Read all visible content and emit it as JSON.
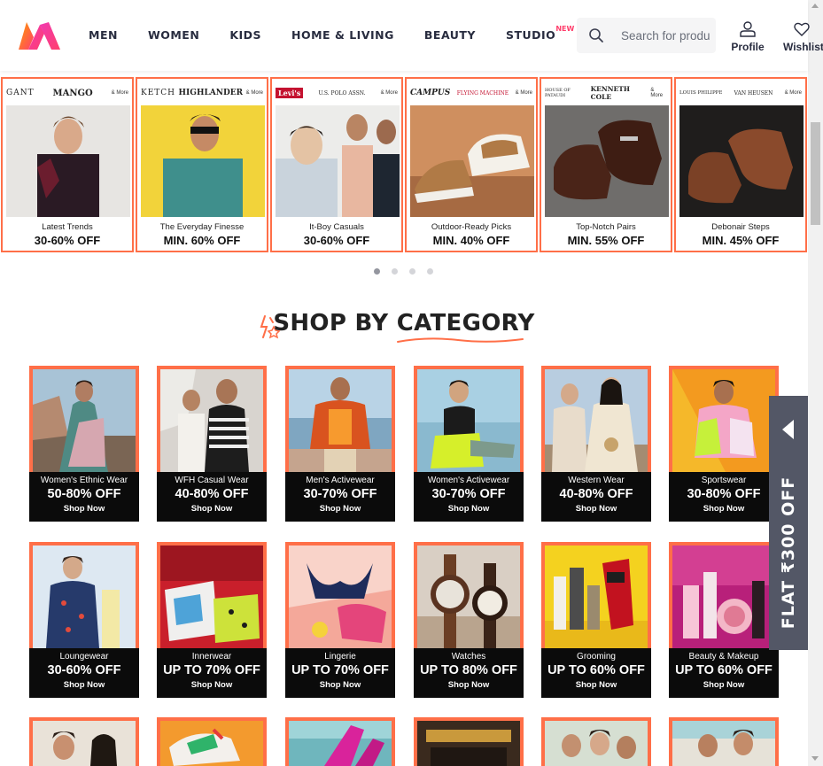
{
  "header": {
    "logo": "myntra-logo",
    "nav": [
      {
        "label": "MEN"
      },
      {
        "label": "WOMEN"
      },
      {
        "label": "KIDS"
      },
      {
        "label": "HOME & LIVING"
      },
      {
        "label": "BEAUTY"
      },
      {
        "label": "STUDIO",
        "badge": "NEW"
      }
    ],
    "search_placeholder": "Search for products, brands and more",
    "profile_label": "Profile",
    "wishlist_label": "Wishlist"
  },
  "colors": {
    "accent": "#ff3f6c",
    "tile_border": "#ff6f48",
    "side_tab": "#535766"
  },
  "brand_carousel": {
    "cards": [
      {
        "brand1": "GANT",
        "brand2": "MANGO",
        "more": "& More",
        "tagline": "Latest Trends",
        "offer": "30-60% OFF"
      },
      {
        "brand1": "KETCH",
        "brand2": "HIGHLANDER",
        "more": "& More",
        "tagline": "The Everyday Finesse",
        "offer": "MIN. 60% OFF"
      },
      {
        "brand1": "Levi's",
        "brand2": "U.S. POLO ASSN.",
        "more": "& More",
        "tagline": "It-Boy Casuals",
        "offer": "30-60% OFF"
      },
      {
        "brand1": "CAMPUS",
        "brand2": "FLYING MACHINE",
        "more": "& More",
        "tagline": "Outdoor-Ready Picks",
        "offer": "MIN. 40% OFF"
      },
      {
        "brand1": "HOUSE OF PATAUDI",
        "brand2": "KENNETH COLE",
        "more": "& More",
        "tagline": "Top-Notch Pairs",
        "offer": "MIN. 55% OFF"
      },
      {
        "brand1": "LOUIS PHILIPPE",
        "brand2": "VAN HEUSEN",
        "more": "& More",
        "tagline": "Debonair Steps",
        "offer": "MIN. 45% OFF"
      }
    ],
    "pages": 4,
    "active_page": 1
  },
  "section_title": "SHOP BY CATEGORY",
  "categories": [
    {
      "name": "Women's Ethnic Wear",
      "offer": "50-80% OFF",
      "cta": "Shop Now"
    },
    {
      "name": "WFH Casual Wear",
      "offer": "40-80% OFF",
      "cta": "Shop Now"
    },
    {
      "name": "Men's Activewear",
      "offer": "30-70% OFF",
      "cta": "Shop Now"
    },
    {
      "name": "Women's Activewear",
      "offer": "30-70% OFF",
      "cta": "Shop Now"
    },
    {
      "name": "Western Wear",
      "offer": "40-80% OFF",
      "cta": "Shop Now"
    },
    {
      "name": "Sportswear",
      "offer": "30-80% OFF",
      "cta": "Shop Now"
    },
    {
      "name": "Loungewear",
      "offer": "30-60% OFF",
      "cta": "Shop Now"
    },
    {
      "name": "Innerwear",
      "offer": "UP TO 70% OFF",
      "cta": "Shop Now"
    },
    {
      "name": "Lingerie",
      "offer": "UP TO 70% OFF",
      "cta": "Shop Now"
    },
    {
      "name": "Watches",
      "offer": "UP TO 80% OFF",
      "cta": "Shop Now"
    },
    {
      "name": "Grooming",
      "offer": "UP TO 60% OFF",
      "cta": "Shop Now"
    },
    {
      "name": "Beauty & Makeup",
      "offer": "UP TO 60% OFF",
      "cta": "Shop Now"
    }
  ],
  "side_tab": {
    "text": "FLAT ₹300 OFF"
  }
}
